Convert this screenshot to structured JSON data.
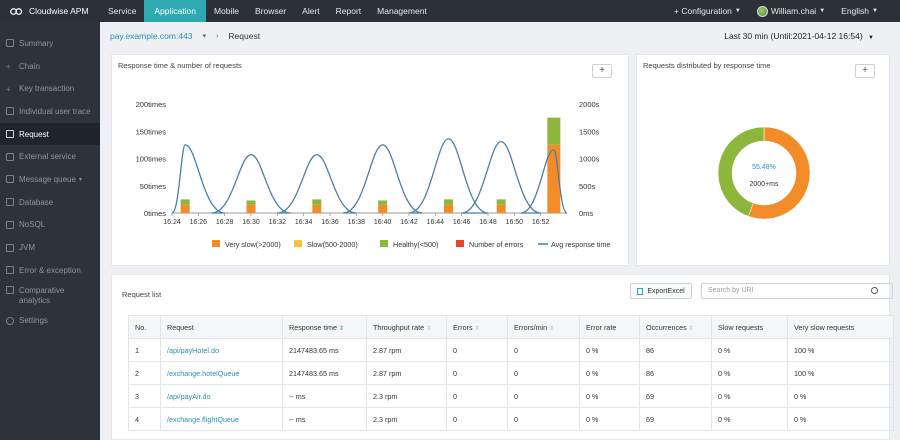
{
  "app": {
    "name": "Cloudwise APM"
  },
  "nav": {
    "items": [
      {
        "label": "Service",
        "active": false
      },
      {
        "label": "Application",
        "active": true
      },
      {
        "label": "Mobile",
        "active": false
      },
      {
        "label": "Browser",
        "active": false
      },
      {
        "label": "Alert",
        "active": false
      },
      {
        "label": "Report",
        "active": false
      },
      {
        "label": "Management",
        "active": false
      }
    ],
    "configuration": "+ Configuration",
    "user": "William.chai",
    "language": "English"
  },
  "sidebar": {
    "items": [
      {
        "label": "Summary",
        "active": false
      },
      {
        "label": "Chain",
        "active": false,
        "expandable": true
      },
      {
        "label": "Key transaction",
        "active": false,
        "expandable": true
      },
      {
        "label": "Individual user trace",
        "active": false
      },
      {
        "label": "Request",
        "active": true
      },
      {
        "label": "External service",
        "active": false
      },
      {
        "label": "Message queue",
        "active": false,
        "expandable": true
      },
      {
        "label": "Database",
        "active": false
      },
      {
        "label": "NoSQL",
        "active": false
      },
      {
        "label": "JVM",
        "active": false
      },
      {
        "label": "Error & exception",
        "active": false
      },
      {
        "label": "Comparative analytics",
        "active": false
      },
      {
        "label": "Settings",
        "active": false
      }
    ]
  },
  "header": {
    "host": "pay.example.com:443",
    "page": "Request",
    "time_range": "Last 30 min (Until:2021-04-12 16:54)"
  },
  "left_panel": {
    "title": "Response time & number of requests",
    "plus": "+"
  },
  "right_panel": {
    "title": "Requests distributed by response time",
    "plus": "+"
  },
  "chart_data": [
    {
      "type": "bar",
      "title": "Response time & number of requests",
      "x_ticks": [
        "16:24",
        "16:26",
        "16:28",
        "16:30",
        "16:32",
        "16:34",
        "16:36",
        "16:38",
        "16:40",
        "16:42",
        "16:44",
        "16:46",
        "16:48",
        "16:50",
        "16:52"
      ],
      "y_left_ticks": [
        "0times",
        "50times",
        "100times",
        "150times",
        "200times"
      ],
      "y_left_range": [
        0,
        200
      ],
      "y_right_ticks": [
        "0ms",
        "500s",
        "1000s",
        "1500s",
        "2000s"
      ],
      "y_right_range": [
        0,
        2000
      ],
      "legend_position": "bottom",
      "grid": false,
      "series": [
        {
          "name": "Very slow(>2000)",
          "color": "#f28c28",
          "kind": "bar",
          "x": [
            "16:25",
            "16:30",
            "16:35",
            "16:40",
            "16:45",
            "16:49",
            "16:53"
          ],
          "values": [
            15,
            15,
            15,
            15,
            15,
            15,
            125
          ]
        },
        {
          "name": "Slow(500-2000)",
          "color": "#f5c242",
          "kind": "bar",
          "x": [
            "16:25",
            "16:30",
            "16:35",
            "16:40",
            "16:45",
            "16:49",
            "16:53"
          ],
          "values": [
            0,
            0,
            0,
            0,
            0,
            0,
            0
          ]
        },
        {
          "name": "Healthy(<500)",
          "color": "#8db63c",
          "kind": "bar",
          "x": [
            "16:25",
            "16:30",
            "16:35",
            "16:40",
            "16:45",
            "16:49",
            "16:53"
          ],
          "values": [
            10,
            8,
            10,
            8,
            10,
            10,
            50
          ]
        },
        {
          "name": "Number of errors",
          "color": "#e8452c",
          "kind": "bar",
          "x": [],
          "values": []
        },
        {
          "name": "Avg response time",
          "color": "#4a7fa8",
          "kind": "line",
          "peaks": [
            {
              "x": "16:25",
              "value": 1250
            },
            {
              "x": "16:30",
              "value": 1070
            },
            {
              "x": "16:35",
              "value": 1070
            },
            {
              "x": "16:40",
              "value": 1250
            },
            {
              "x": "16:45",
              "value": 1360
            },
            {
              "x": "16:49",
              "value": 1310
            },
            {
              "x": "16:53",
              "value": 1160
            }
          ]
        }
      ]
    },
    {
      "type": "pie",
      "title": "Requests distributed by response time",
      "center_labels": [
        "55.48%",
        "2000+ms"
      ],
      "slices": [
        {
          "label": "2000+ms",
          "value": 55.48,
          "color": "#f28c28"
        },
        {
          "label": "Healthy",
          "value": 44.52,
          "color": "#8db63c"
        }
      ]
    }
  ],
  "request_list": {
    "title": "Request list",
    "export_label": "ExportExcel",
    "search_placeholder": "Search by URI",
    "columns": [
      "No.",
      "Request",
      "Response time",
      "Throughput rate",
      "Errors",
      "Errors/min",
      "Error rate",
      "Occurrences",
      "Slow requests",
      "Very slow requests"
    ],
    "rows": [
      [
        "1",
        "/api/payHotel.do",
        "2147483.65 ms",
        "2.87 rpm",
        "0",
        "0",
        "0 %",
        "86",
        "0 %",
        "100 %"
      ],
      [
        "2",
        "/exchange.hotelQueue",
        "2147483.65 ms",
        "2.87 rpm",
        "0",
        "0",
        "0 %",
        "86",
        "0 %",
        "100 %"
      ],
      [
        "3",
        "/api/payAir.do",
        "-- ms",
        "2.3 rpm",
        "0",
        "0",
        "0 %",
        "69",
        "0 %",
        "0 %"
      ],
      [
        "4",
        "/exchange.flightQueue",
        "-- ms",
        "2.3 rpm",
        "0",
        "0",
        "0 %",
        "69",
        "0 %",
        "0 %"
      ]
    ]
  }
}
